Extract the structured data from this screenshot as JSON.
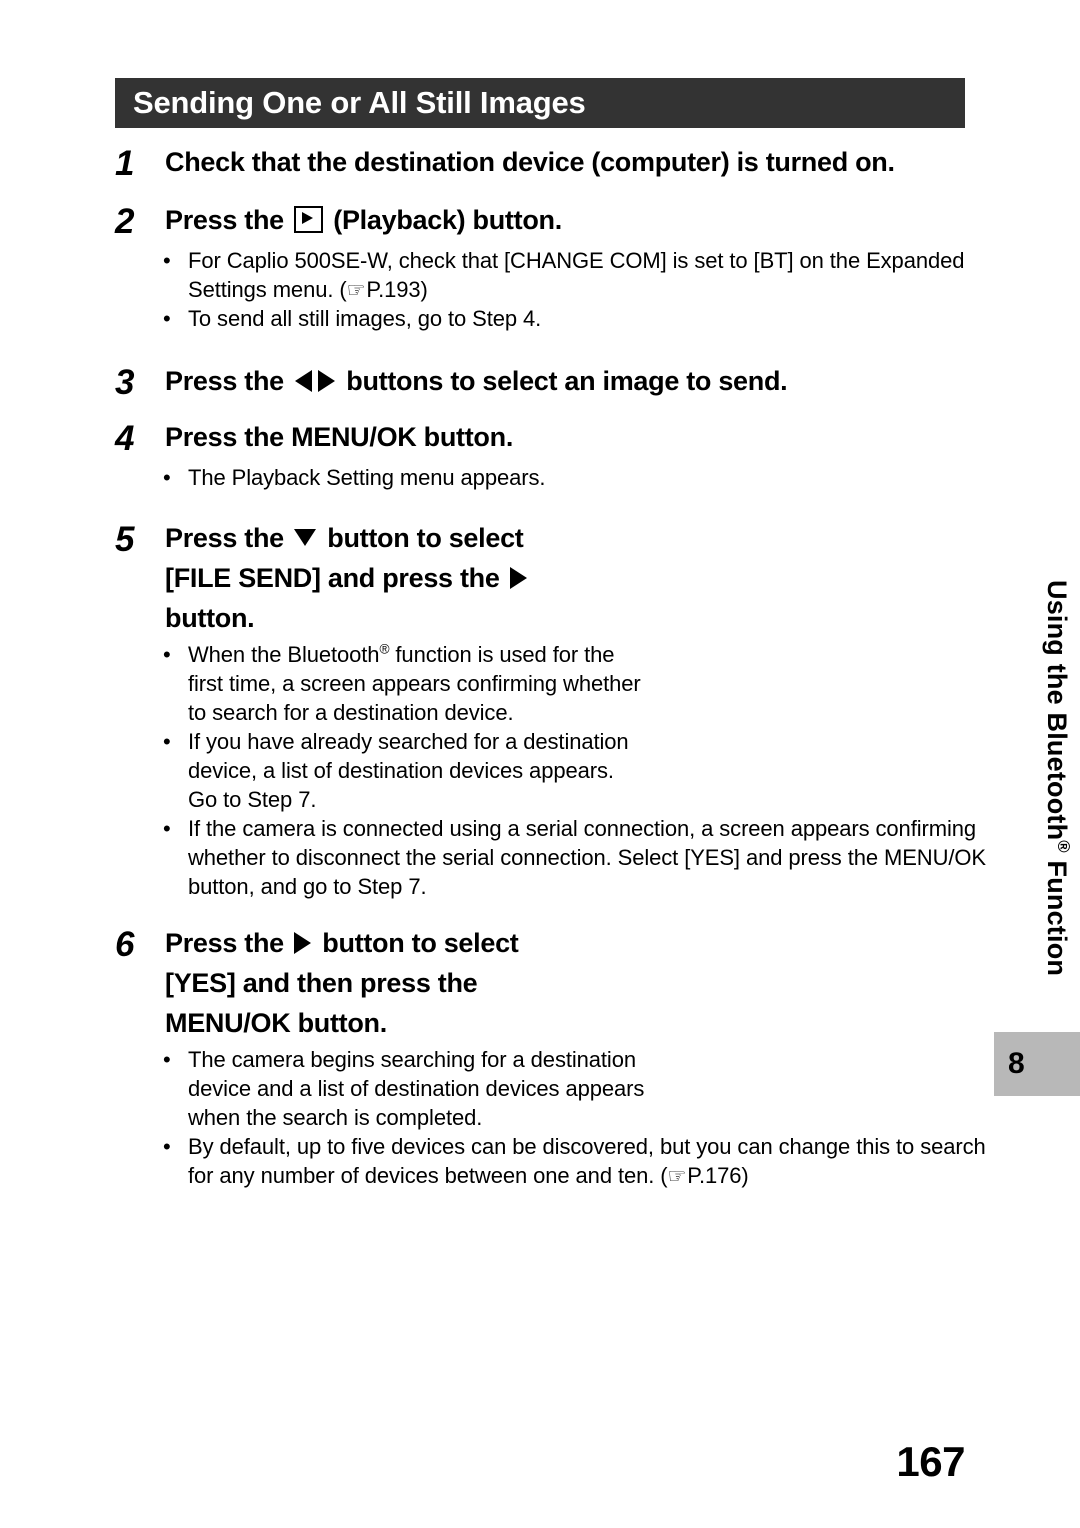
{
  "header": {
    "section_title": "Sending One or All Still Images",
    "banner_color": "#333333",
    "banner_text_color": "#ffffff"
  },
  "side_tab": {
    "chapter_title_part1": "Using the Bluetooth",
    "chapter_title_reg": "®",
    "chapter_title_part2": " Function",
    "chapter_number": "8",
    "chapter_box_color": "#b8b8b8"
  },
  "footer": {
    "page_number": "167"
  },
  "steps": [
    {
      "number": "1",
      "title": "Check that the destination device (computer) is turned on.",
      "bullets": []
    },
    {
      "number": "2",
      "title_before_icon": "Press the ",
      "icon": "playback-icon",
      "title_after_icon": " (Playback) button.",
      "bullets": [
        {
          "text_1": "For Caplio 500SE-W, check that [CHANGE COM] is set to [BT] on the Expanded Settings menu. (",
          "ref_icon": "☞",
          "ref_page": "P.193",
          "text_2": ")"
        },
        {
          "text_1": "To send all still images, go to Step 4."
        }
      ]
    },
    {
      "number": "3",
      "title_before_icon": "Press the ",
      "icon": "left-right-arrows-icon",
      "title_after_icon": " buttons to select an image to send.",
      "bullets": []
    },
    {
      "number": "4",
      "title": "Press the MENU/OK button.",
      "bullets": [
        {
          "text_1": "The Playback Setting menu appears."
        }
      ]
    },
    {
      "number": "5",
      "title_before_icon": "Press the ",
      "icon": "down-arrow-icon",
      "title_middle": " button to select [FILE SEND] and press the ",
      "icon_2": "right-arrow-icon",
      "title_after_icon": " button.",
      "bullets": [
        {
          "text_1": "When the Bluetooth",
          "reg": "®",
          "text_2": " function is used for the first time, a screen appears confirming whether to search for a destination device."
        },
        {
          "text_1": "If you have already searched for a destination device, a list of destination devices appears. Go to Step 7."
        },
        {
          "text_1": "If the camera is connected using a serial connection, a screen appears confirming whether to disconnect the serial connection. Select [YES] and press the MENU/OK button, and go to Step 7."
        }
      ]
    },
    {
      "number": "6",
      "title_before_icon": "Press the ",
      "icon": "right-arrow-icon",
      "title_after_icon": " button to select [YES] and then press the MENU/OK button.",
      "bullets": [
        {
          "text_1": "The camera begins searching for a destination device and a list of destination devices appears when the search is completed."
        },
        {
          "text_1": "By default, up to five devices can be discovered, but you can change this to search for any number of devices between one and ten. (",
          "ref_icon": "☞",
          "ref_page": "P.176",
          "text_2": ")"
        }
      ]
    }
  ],
  "bullet_marker": "•"
}
